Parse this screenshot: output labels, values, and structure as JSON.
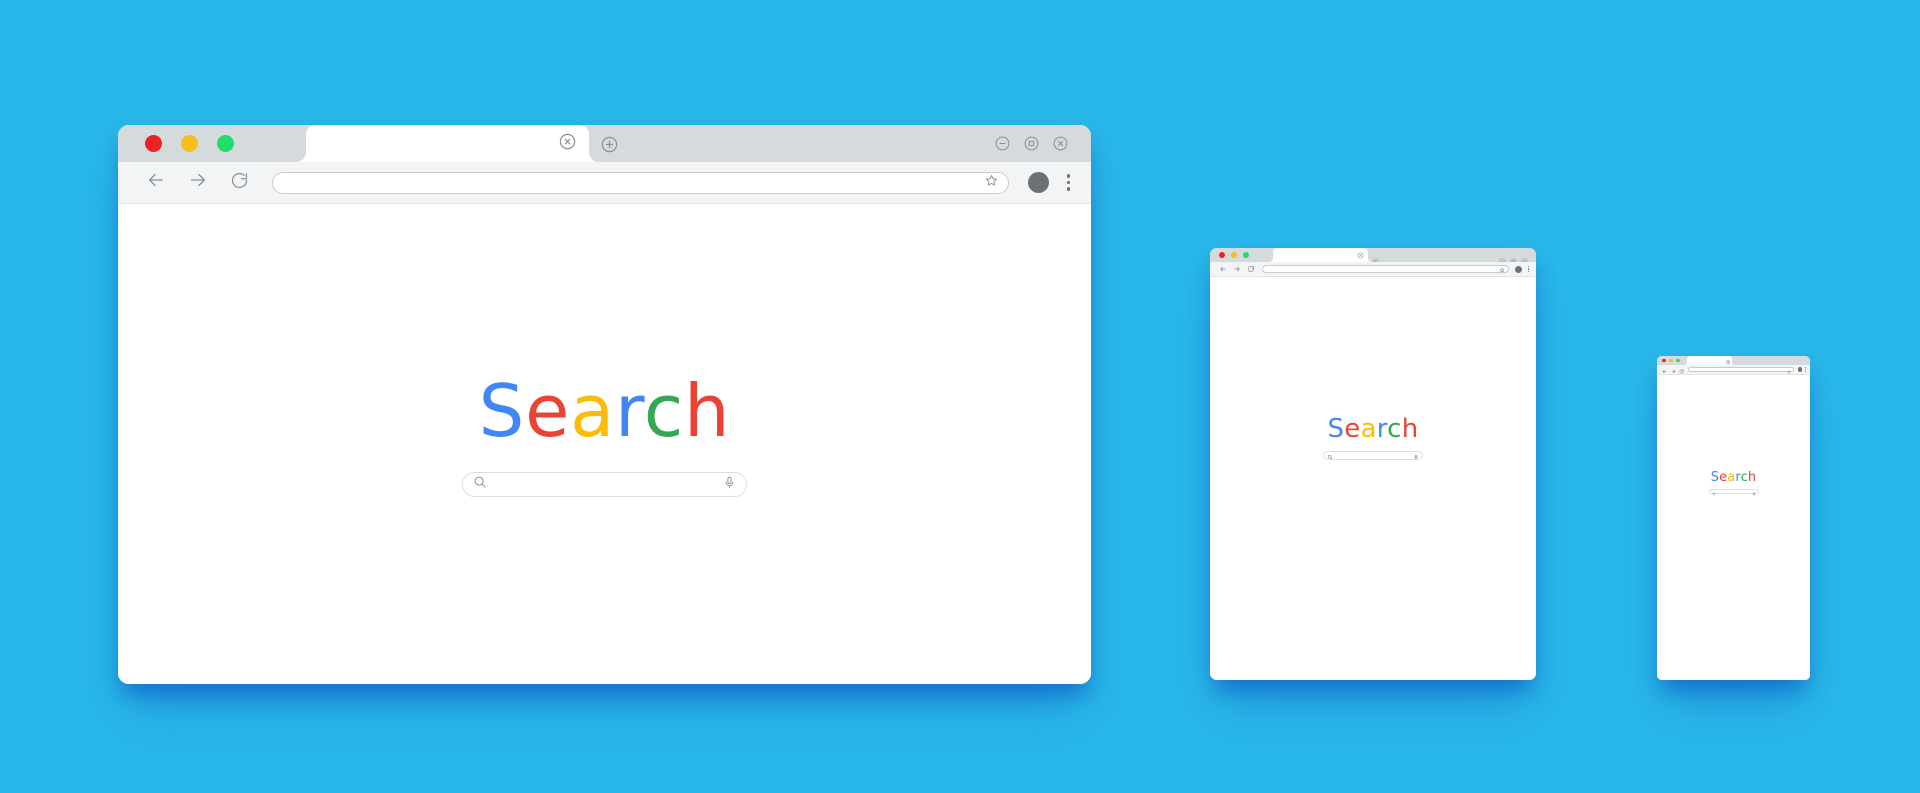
{
  "scene": {
    "background_color": "#29b6e8",
    "description": "Responsive browser window mockups"
  },
  "logo": {
    "text": "Search",
    "letters": [
      {
        "char": "S",
        "color": "#4285f4"
      },
      {
        "char": "e",
        "color": "#ea4335"
      },
      {
        "char": "a",
        "color": "#fbbc05"
      },
      {
        "char": "r",
        "color": "#4285f4"
      },
      {
        "char": "c",
        "color": "#34a853"
      },
      {
        "char": "h",
        "color": "#ea4335"
      }
    ]
  },
  "search": {
    "value": "",
    "placeholder": ""
  },
  "url": {
    "value": "",
    "placeholder": ""
  },
  "traffic_lights": [
    {
      "name": "close",
      "color": "#ee2222"
    },
    {
      "name": "minimize",
      "color": "#f5c01c"
    },
    {
      "name": "zoom",
      "color": "#21dd6e"
    }
  ],
  "toolbar": {
    "back_label": "Back",
    "forward_label": "Forward",
    "reload_label": "Reload",
    "bookmark_label": "Bookmark",
    "profile_label": "Profile",
    "menu_label": "Menu"
  },
  "tab": {
    "title": "",
    "close_label": "Close tab",
    "newtab_label": "New tab"
  },
  "window_controls": {
    "minimize_label": "Minimize",
    "maximize_label": "Maximize",
    "close_label": "Close"
  },
  "windows": [
    {
      "id": "desktop",
      "device": "desktop"
    },
    {
      "id": "tablet",
      "device": "tablet"
    },
    {
      "id": "phone",
      "device": "phone"
    }
  ]
}
